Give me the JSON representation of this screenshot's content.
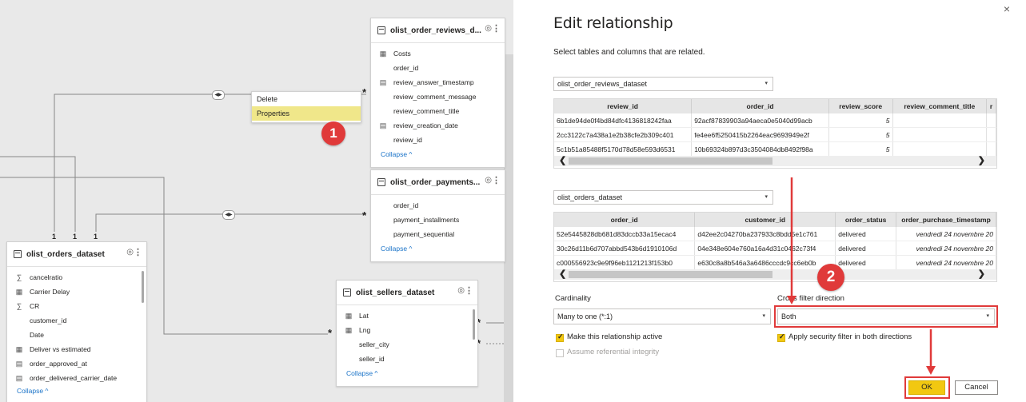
{
  "canvas": {
    "reviews_table": {
      "name": "olist_order_reviews_d...",
      "fields": [
        {
          "icon": "table-icon",
          "label": "Costs"
        },
        {
          "icon": "",
          "label": "order_id"
        },
        {
          "icon": "calendar-icon",
          "label": "review_answer_timestamp"
        },
        {
          "icon": "",
          "label": "review_comment_message"
        },
        {
          "icon": "",
          "label": "review_comment_title"
        },
        {
          "icon": "calendar-icon",
          "label": "review_creation_date"
        },
        {
          "icon": "",
          "label": "review_id"
        }
      ],
      "collapse": "Collapse ^"
    },
    "payments_table": {
      "name": "olist_order_payments...",
      "fields": [
        {
          "icon": "",
          "label": "order_id"
        },
        {
          "icon": "",
          "label": "payment_installments"
        },
        {
          "icon": "",
          "label": "payment_sequential"
        }
      ],
      "collapse": "Collapse ^"
    },
    "orders_table": {
      "name": "olist_orders_dataset",
      "fields": [
        {
          "icon": "sigma-icon",
          "label": "cancelratio"
        },
        {
          "icon": "table-icon",
          "label": "Carrier Delay"
        },
        {
          "icon": "sigma-icon",
          "label": "CR"
        },
        {
          "icon": "",
          "label": "customer_id"
        },
        {
          "icon": "",
          "label": "Date"
        },
        {
          "icon": "table-icon",
          "label": "Deliver vs estimated"
        },
        {
          "icon": "calendar-icon",
          "label": "order_approved_at"
        },
        {
          "icon": "calendar-icon",
          "label": "order_delivered_carrier_date"
        }
      ],
      "collapse": "Collapse ^"
    },
    "sellers_table": {
      "name": "olist_sellers_dataset",
      "fields": [
        {
          "icon": "table-icon",
          "label": "Lat"
        },
        {
          "icon": "table-icon",
          "label": "Lng"
        },
        {
          "icon": "",
          "label": "seller_city"
        },
        {
          "icon": "",
          "label": "seller_id"
        }
      ],
      "collapse": "Collapse ^"
    },
    "context_menu": {
      "delete": "Delete",
      "properties": "Properties"
    },
    "badge1": "1",
    "cardinality_one": "1",
    "cardinality_many": "*"
  },
  "dialog": {
    "title": "Edit relationship",
    "subtitle": "Select tables and columns that are related.",
    "close": "×",
    "table1": {
      "selected": "olist_order_reviews_dataset",
      "columns": [
        "review_id",
        "order_id",
        "review_score",
        "review_comment_title",
        "r"
      ],
      "rows": [
        [
          "6b1de94de0f4bd84dfc4136818242faa",
          "92acf87839903a94aeca0e5040d99acb",
          "5",
          "",
          ""
        ],
        [
          "2cc3122c7a438a1e2b38cfe2b309c401",
          "fe4ee6f5250415b2264eac9693949e2f",
          "5",
          "",
          ""
        ],
        [
          "5c1b51a85488f5170d78d58e593d6531",
          "10b69324b897d3c3504084db8492f98a",
          "5",
          "",
          ""
        ]
      ]
    },
    "table2": {
      "selected": "olist_orders_dataset",
      "columns": [
        "order_id",
        "customer_id",
        "order_status",
        "order_purchase_timestamp"
      ],
      "rows": [
        [
          "52e5445828db681d83dccb33a15ecac4",
          "d42ee2c04270ba237933c8bdd5e1c761",
          "delivered",
          "vendredi 24 novembre 20"
        ],
        [
          "30c26d11b6d707abbd543b6d1910106d",
          "04e348e604e760a16a4d31c0462c73f4",
          "delivered",
          "vendredi 24 novembre 20"
        ],
        [
          "c000556923c9e9f96eb1121213f153b0",
          "e630c8a8b546a3a6486cccdc9cc6eb0b",
          "delivered",
          "vendredi 24 novembre 20"
        ]
      ]
    },
    "cardinality_label": "Cardinality",
    "cardinality_value": "Many to one (*:1)",
    "crossfilter_label": "Cross filter direction",
    "crossfilter_value": "Both",
    "active_label": "Make this relationship active",
    "integrity_label": "Assume referential integrity",
    "security_label": "Apply security filter in both directions",
    "ok": "OK",
    "cancel": "Cancel",
    "badge2": "2"
  },
  "colors": {
    "accent_yellow": "#f2c811",
    "annotation_red": "#e03a3a",
    "link_blue": "#1a73c8"
  }
}
